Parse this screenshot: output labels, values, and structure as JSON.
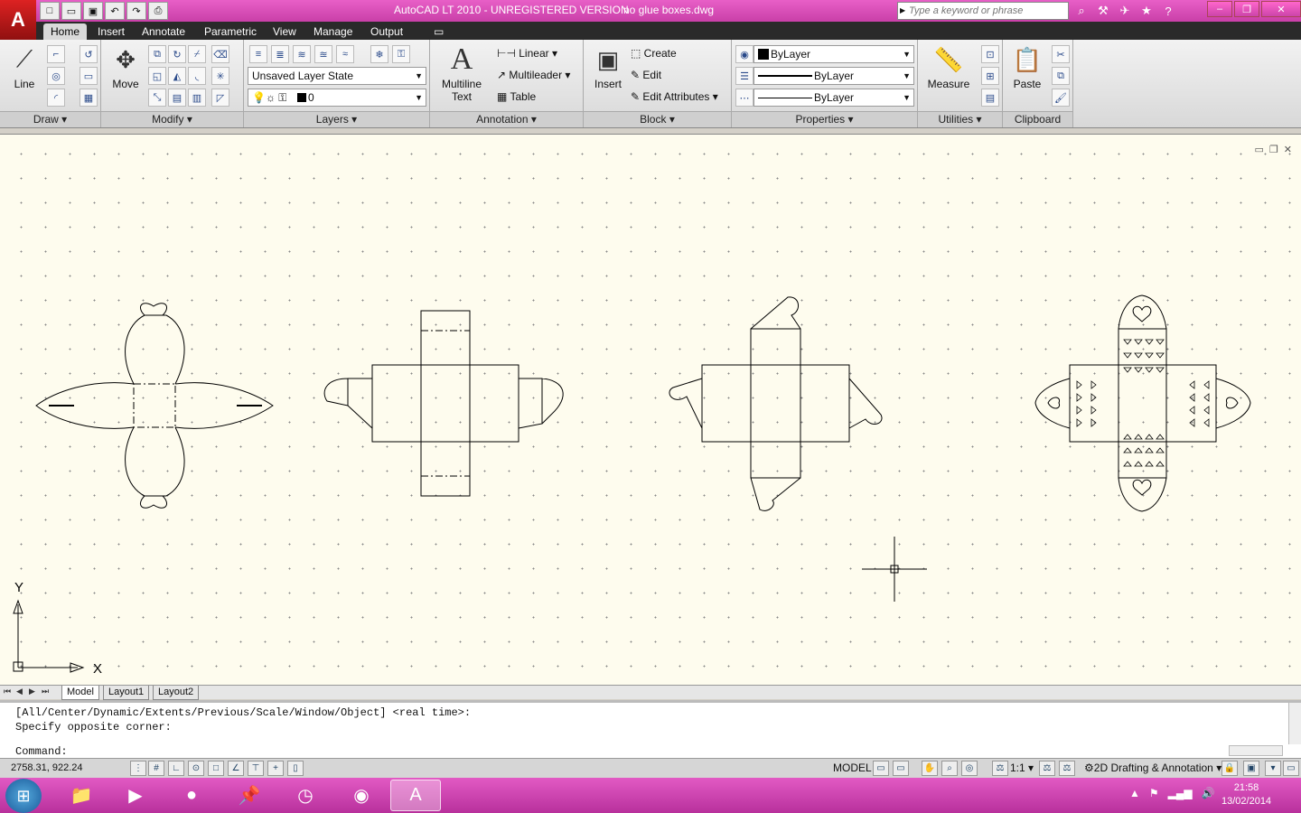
{
  "window": {
    "title": "AutoCAD LT 2010 - UNREGISTERED VERSION",
    "filename": "no glue boxes.dwg",
    "search_placeholder": "Type a keyword or phrase"
  },
  "ribbon_tabs": [
    "Home",
    "Insert",
    "Annotate",
    "Parametric",
    "View",
    "Manage",
    "Output"
  ],
  "panels": {
    "draw": {
      "title": "Draw",
      "line_label": "Line"
    },
    "modify": {
      "title": "Modify",
      "move_label": "Move"
    },
    "layers": {
      "title": "Layers",
      "layer_state": "Unsaved Layer State",
      "current_layer": "0"
    },
    "annotation": {
      "title": "Annotation",
      "mtext_line1": "Multiline",
      "mtext_line2": "Text",
      "linear": "Linear",
      "multileader": "Multileader",
      "table": "Table"
    },
    "block": {
      "title": "Block",
      "insert": "Insert",
      "create": "Create",
      "edit": "Edit",
      "edit_attributes": "Edit Attributes"
    },
    "properties": {
      "title": "Properties",
      "color": "ByLayer",
      "linetype": "ByLayer",
      "lineweight": "ByLayer"
    },
    "utilities": {
      "title": "Utilities",
      "measure": "Measure"
    },
    "clipboard": {
      "title": "Clipboard",
      "paste": "Paste"
    }
  },
  "ucs": {
    "x_label": "X",
    "y_label": "Y"
  },
  "layout_tabs": [
    "Model",
    "Layout1",
    "Layout2"
  ],
  "command": {
    "line1": "[All/Center/Dynamic/Extents/Previous/Scale/Window/Object] <real time>:",
    "line2": "Specify opposite corner:",
    "prompt": "Command:"
  },
  "status": {
    "coords": "2758.31, 922.24",
    "model": "MODEL",
    "scale": "1:1",
    "workspace": "2D Drafting & Annotation"
  },
  "taskbar": {
    "time": "21:58",
    "date": "13/02/2014"
  },
  "colors": {
    "titlebar": "#d94bbd",
    "canvas": "#fefcee",
    "ribbon_tabbar": "#2a2a2a"
  }
}
